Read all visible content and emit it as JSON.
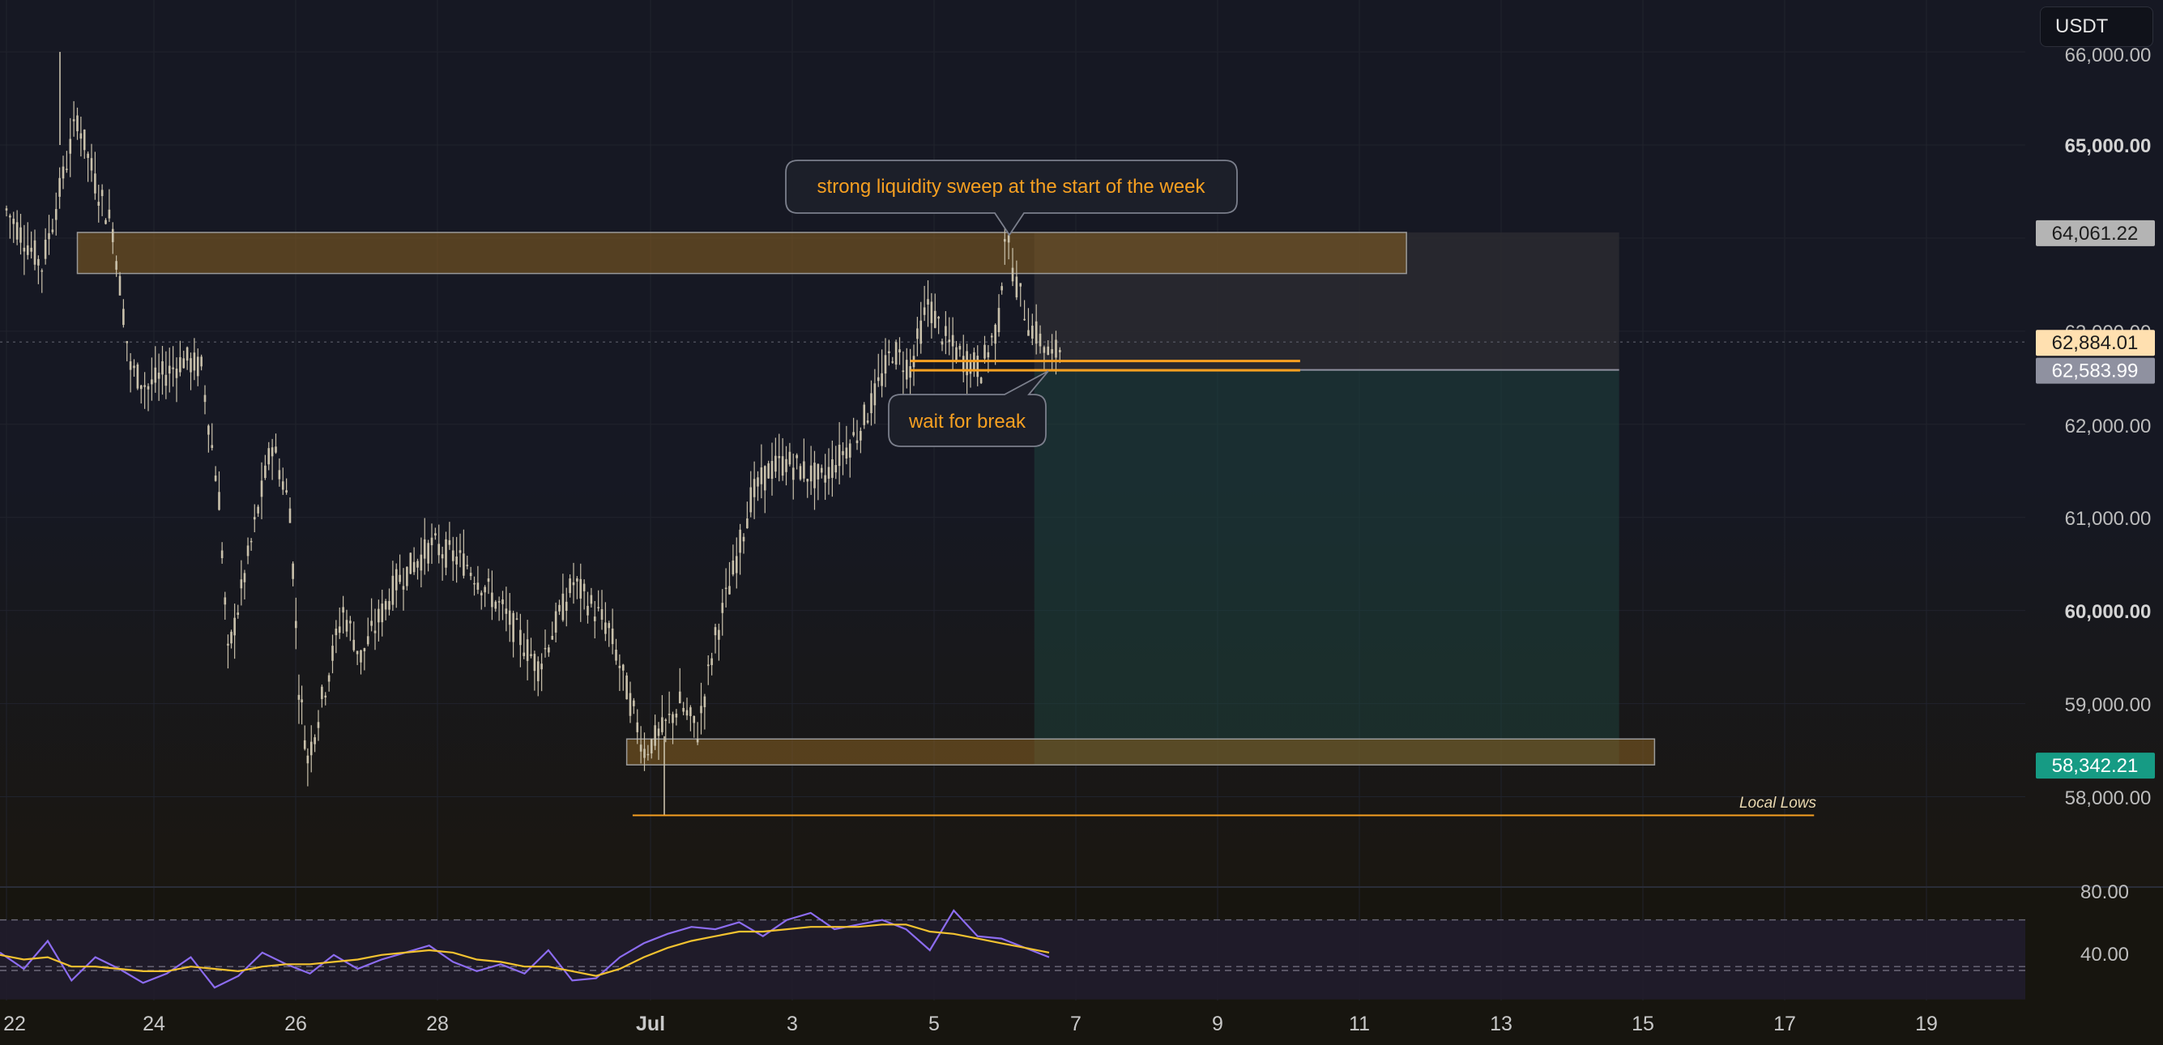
{
  "toolbar": {
    "currency_label": "USDT"
  },
  "colors": {
    "background": "#161823",
    "candle": "#c9c1ab",
    "orange": "#f7a021",
    "zone_fill": "#8a6222",
    "profit_fill": "#1f4a42",
    "rsi_line": "#8c6cf0",
    "rsi_ma": "#f2c230",
    "badge_green": "#169b84"
  },
  "chart_data": {
    "type": "candlestick",
    "title": "",
    "xlabel": "",
    "ylabel": "",
    "x_tick_labels": [
      "22",
      "24",
      "26",
      "28",
      "Jul",
      "3",
      "5",
      "7",
      "9",
      "11",
      "13",
      "15",
      "17",
      "19"
    ],
    "y_tick_labels": [
      "66,000.00",
      "65,000.00",
      "63,000.00",
      "62,000.00",
      "61,000.00",
      "60,000.00",
      "59,000.00",
      "58,000.00"
    ],
    "ylim": [
      57070,
      66660
    ],
    "price_series": [
      {
        "date": "Jun 22",
        "price": 64300
      },
      {
        "date": "Jun 22 12h",
        "price": 63700
      },
      {
        "date": "Jun 23",
        "price": 65300
      },
      {
        "date": "Jun 23 06h",
        "price": 64600
      },
      {
        "date": "Jun 23 12h",
        "price": 64100
      },
      {
        "date": "Jun 23 18h",
        "price": 62600
      },
      {
        "date": "Jun 24",
        "price": 62400
      },
      {
        "date": "Jun 24 12h",
        "price": 62700
      },
      {
        "date": "Jun 24 18h",
        "price": 62600
      },
      {
        "date": "Jun 25",
        "price": 61200
      },
      {
        "date": "Jun 25 03h",
        "price": 59500
      },
      {
        "date": "Jun 25 12h",
        "price": 60900
      },
      {
        "date": "Jun 25 18h",
        "price": 61800
      },
      {
        "date": "Jun 26",
        "price": 61100
      },
      {
        "date": "Jun 26 03h",
        "price": 59200
      },
      {
        "date": "Jun 26 06h",
        "price": 58400
      },
      {
        "date": "Jun 26 18h",
        "price": 60000
      },
      {
        "date": "Jun 27",
        "price": 59500
      },
      {
        "date": "Jun 27 12h",
        "price": 60300
      },
      {
        "date": "Jun 28",
        "price": 60700
      },
      {
        "date": "Jun 28 12h",
        "price": 60500
      },
      {
        "date": "Jun 29",
        "price": 60000
      },
      {
        "date": "Jun 29 12h",
        "price": 59400
      },
      {
        "date": "Jun 30",
        "price": 60300
      },
      {
        "date": "Jun 30 12h",
        "price": 59800
      },
      {
        "date": "Jul 1",
        "price": 58500
      },
      {
        "date": "Jul 1 06h",
        "price": 58700
      },
      {
        "date": "Jul 1 12h",
        "price": 59000
      },
      {
        "date": "Jul 1 18h",
        "price": 58700
      },
      {
        "date": "Jul 2",
        "price": 59700
      },
      {
        "date": "Jul 2 06h",
        "price": 60400
      },
      {
        "date": "Jul 2 12h",
        "price": 61200
      },
      {
        "date": "Jul 2 18h",
        "price": 61500
      },
      {
        "date": "Jul 3",
        "price": 61600
      },
      {
        "date": "Jul 3 12h",
        "price": 61400
      },
      {
        "date": "Jul 4",
        "price": 61900
      },
      {
        "date": "Jul 4 06h",
        "price": 62300
      },
      {
        "date": "Jul 4 12h",
        "price": 62800
      },
      {
        "date": "Jul 4 18h",
        "price": 62600
      },
      {
        "date": "Jul 5",
        "price": 63300
      },
      {
        "date": "Jul 5 06h",
        "price": 62900
      },
      {
        "date": "Jul 5 12h",
        "price": 62700
      },
      {
        "date": "Jul 5 18h",
        "price": 62600
      },
      {
        "date": "Jul 6",
        "price": 63100
      },
      {
        "date": "Jul 6 02h",
        "price": 64061
      },
      {
        "date": "Jul 6 06h",
        "price": 63500
      },
      {
        "date": "Jul 6 10h",
        "price": 63100
      },
      {
        "date": "Jul 6 14h",
        "price": 62900
      },
      {
        "date": "Jul 6 18h",
        "price": 62700
      },
      {
        "date": "Jul 6 22h",
        "price": 62884
      }
    ],
    "last_price": 62884.01,
    "dashed_price_line": 62884.01,
    "price_badges": [
      {
        "text": "64,061.22",
        "price": 64061.22,
        "bg": "#b4b4b4",
        "fg": "#1c1c1c"
      },
      {
        "text": "62,884.01",
        "price": 62884.01,
        "bg": "#ffe0b0",
        "fg": "#1c1c1c"
      },
      {
        "text": "62,583.99",
        "price": 62583.99,
        "bg": "#8f91a0",
        "fg": "#ffffff"
      },
      {
        "text": "58,342.21",
        "price": 58342.21,
        "bg": "#169b84",
        "fg": "#ffffff"
      }
    ],
    "zones": [
      {
        "name": "supply-zone",
        "x_start": "Jun 23",
        "x_end": "Jul 11 18h",
        "y_low": 63620,
        "y_high": 64061
      },
      {
        "name": "demand-zone",
        "x_start": "Jun 30 18h",
        "x_end": "Jul 15 06h",
        "y_low": 58342,
        "y_high": 58620
      }
    ],
    "position": {
      "entry": 62583.99,
      "stop": 64061.22,
      "target": 58342.21,
      "x_start": "Jul 6 12h",
      "x_end": "Jul 14 18h"
    },
    "lines": [
      {
        "name": "upper-break-line",
        "price": 62680,
        "x_start": "Jul 4 18h",
        "x_end": "Jul 10 06h"
      },
      {
        "name": "lower-break-line",
        "price": 62580,
        "x_start": "Jul 4 18h",
        "x_end": "Jul 10 06h"
      },
      {
        "name": "local-lows-line",
        "price": 57800,
        "x_start": "Jun 30 20h",
        "x_end": "Jul 17 12h"
      }
    ],
    "annotations": [
      {
        "name": "sweep-callout",
        "text": "strong liquidity sweep at the start of the week"
      },
      {
        "name": "break-callout",
        "text": "wait for break"
      },
      {
        "name": "local-lows-label",
        "text": "Local Lows"
      }
    ],
    "rsi": {
      "y_tick_labels": [
        "80.00",
        "40.00"
      ],
      "ylim": [
        30,
        82
      ],
      "values": [
        56,
        49,
        61,
        44,
        54,
        49,
        43,
        47,
        54,
        41,
        46,
        56,
        51,
        47,
        55,
        49,
        53,
        56,
        59,
        52,
        48,
        51,
        47,
        57,
        44,
        45,
        54,
        60,
        64,
        67,
        66,
        69,
        63,
        70,
        73,
        66,
        68,
        70,
        66,
        57,
        74,
        63,
        62,
        58,
        54
      ],
      "ma": [
        55,
        53,
        54,
        50,
        50,
        49,
        48,
        48,
        50,
        49,
        48,
        50,
        51,
        51,
        52,
        53,
        55,
        56,
        57,
        56,
        53,
        52,
        50,
        50,
        48,
        46,
        49,
        54,
        58,
        61,
        63,
        65,
        65,
        66,
        67,
        67,
        67,
        68,
        68,
        65,
        64,
        62,
        60,
        58,
        56
      ]
    }
  }
}
